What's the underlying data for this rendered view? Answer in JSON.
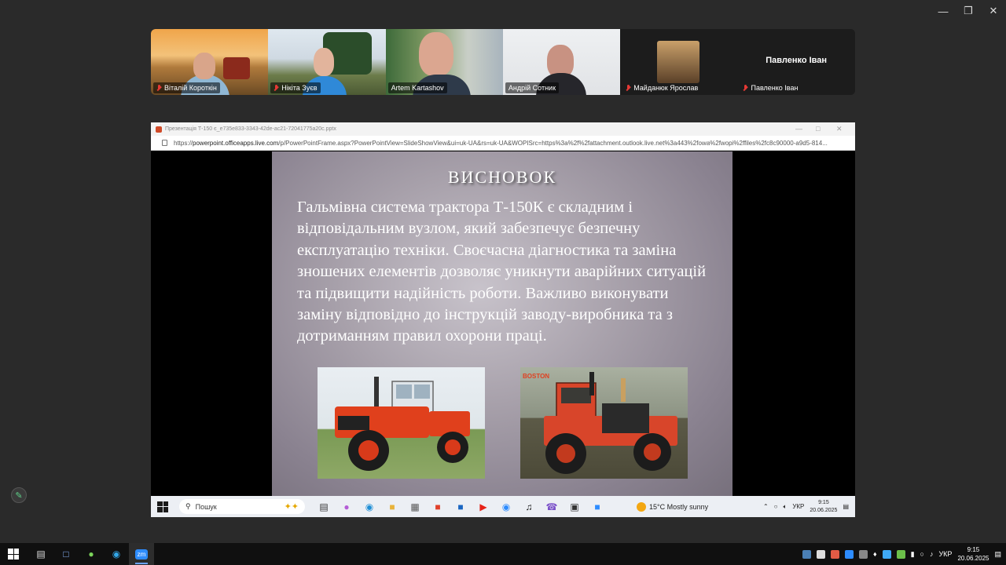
{
  "participants": [
    {
      "name": "Віталій Короткін",
      "muted": true,
      "active": false
    },
    {
      "name": "Нікіта Зуєв",
      "muted": true,
      "active": false
    },
    {
      "name": "Artem Kartashov",
      "muted": false,
      "active": false
    },
    {
      "name": "Андрій Сотник",
      "muted": false,
      "active": true
    },
    {
      "name": "Майданюк Ярослав",
      "muted": true,
      "active": false
    },
    {
      "name": "Павленко Іван",
      "muted": true,
      "active": false,
      "display_name": "Павленко Іван"
    }
  ],
  "shared_window": {
    "title": "Презентація Т-150 є_e735e833-3343-42de-ac21-72041775a20c.pptx",
    "url_prefix": "https://",
    "url_domain": "powerpoint.officeapps.live.com",
    "url_rest": "/p/PowerPointFrame.aspx?PowerPointView=SlideShowView&ui=uk-UA&rs=uk-UA&WOPISrc=https%3a%2f%2fattachment.outlook.live.net%3a443%2fowa%2fwopi%2ffiles%2fc8c90000-a9d5-814..."
  },
  "slide": {
    "title": "ВИСНОВОК",
    "body": "Гальмівна система трактора Т-150К є складним і відповідальним вузлом, який забезпечує безпечну експлуатацію техніки. Своєчасна діагностика та заміна зношених елементів дозволяє уникнути аварійних ситуацій та підвищити надійність роботи. Важливо виконувати заміну відповідно до інструкцій заводу-виробника та з дотриманням правил охорони праці.",
    "photo2_label": "BOSTON"
  },
  "remote_taskbar": {
    "search_label": "Пошук",
    "weather": "15°C  Mostly sunny",
    "lang": "УКР",
    "time": "9:15",
    "date": "20.06.2025"
  },
  "local_taskbar": {
    "lang": "УКР",
    "time": "9:15",
    "date": "20.06.2025",
    "apps": [
      "file-explorer-icon",
      "android-icon",
      "edge-icon",
      "zoom-icon"
    ]
  },
  "colors": {
    "active_speaker": "#2ecc71",
    "muted_mic": "#e53935",
    "slide_bg": "#a7a0aa",
    "tractor_red": "#e0401c"
  }
}
